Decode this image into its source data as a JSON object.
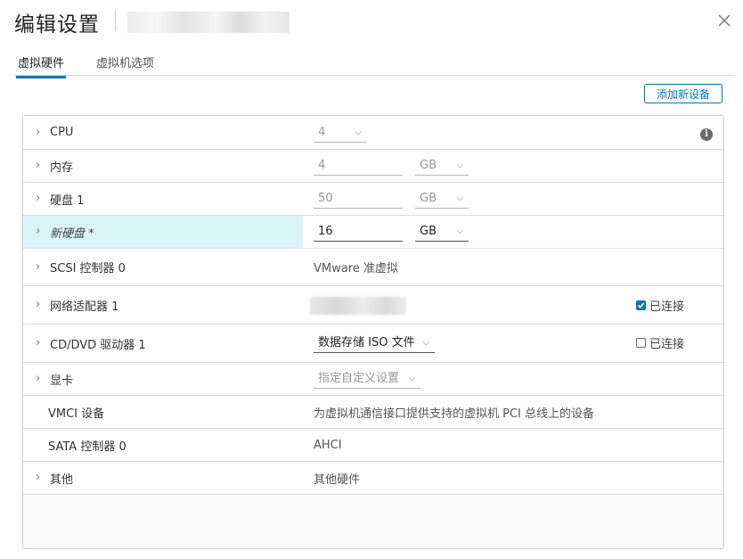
{
  "dialog": {
    "title": "编辑设置",
    "close_label": "×"
  },
  "tabs": [
    {
      "label": "虚拟硬件",
      "active": true
    },
    {
      "label": "虚拟机选项",
      "active": false
    }
  ],
  "toolbar": {
    "add_device_label": "添加新设备"
  },
  "rows": {
    "cpu": {
      "label": "CPU",
      "value": "4"
    },
    "memory": {
      "label": "内存",
      "value": "4",
      "unit": "GB"
    },
    "disk1": {
      "label": "硬盘 1",
      "value": "50",
      "unit": "GB"
    },
    "newdisk": {
      "label": "新硬盘 *",
      "value": "16",
      "unit": "GB"
    },
    "scsi": {
      "label": "SCSI 控制器 0",
      "value": "VMware 准虚拟"
    },
    "nic": {
      "label": "网络适配器 1",
      "connected_label": "已连接",
      "connected": true
    },
    "cddvd": {
      "label": "CD/DVD 驱动器 1",
      "value": "数据存储 ISO 文件",
      "connected_label": "已连接",
      "connected": false
    },
    "video": {
      "label": "显卡",
      "value": "指定自定义设置"
    },
    "vmci": {
      "label": "VMCI 设备",
      "value": "为虚拟机通信接口提供支持的虚拟机 PCI 总线上的设备"
    },
    "sata": {
      "label": "SATA 控制器 0",
      "value": "AHCI"
    },
    "other": {
      "label": "其他",
      "value": "其他硬件"
    }
  },
  "colors": {
    "accent": "#0079b8",
    "highlight": "#d9f6f7"
  }
}
